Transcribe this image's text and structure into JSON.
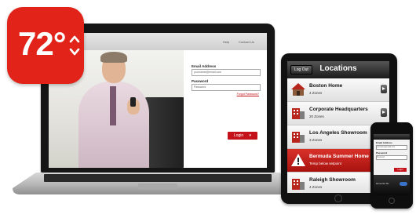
{
  "logo": {
    "text": "72°",
    "icon": "up-down-arrows-icon",
    "color": "#e2231a"
  },
  "laptop": {
    "toplinks": [
      "Help",
      "Contact Us"
    ],
    "email_label": "Email Address",
    "email_value": "yourname@email.com",
    "password_label": "Password",
    "password_value": "Password",
    "forgot_link": "Forgot Password?",
    "login_button": "Login"
  },
  "tablet": {
    "logout_button": "Log Out",
    "title": "Locations",
    "locations": [
      {
        "name": "Boston Home",
        "sub": "4 Zones",
        "icon": "house-icon"
      },
      {
        "name": "Corporate Headquarters",
        "sub": "20 Zones",
        "icon": "building-icon"
      },
      {
        "name": "Los Angeles Showroom",
        "sub": "3 Zones",
        "icon": "building-icon"
      },
      {
        "name": "Bermuda Summer Home",
        "sub": "Temp below setpoint",
        "icon": "warning-icon",
        "alert": true
      },
      {
        "name": "Raleigh Showroom",
        "sub": "4 Zones",
        "icon": "building-icon"
      }
    ]
  },
  "phone": {
    "email_label": "Email Address",
    "email_value": "yourname@email.com",
    "password_label": "Password",
    "password_value": "Password",
    "login_button": "Login",
    "footer_text": "Remember Me",
    "accent": "#c4111a"
  }
}
